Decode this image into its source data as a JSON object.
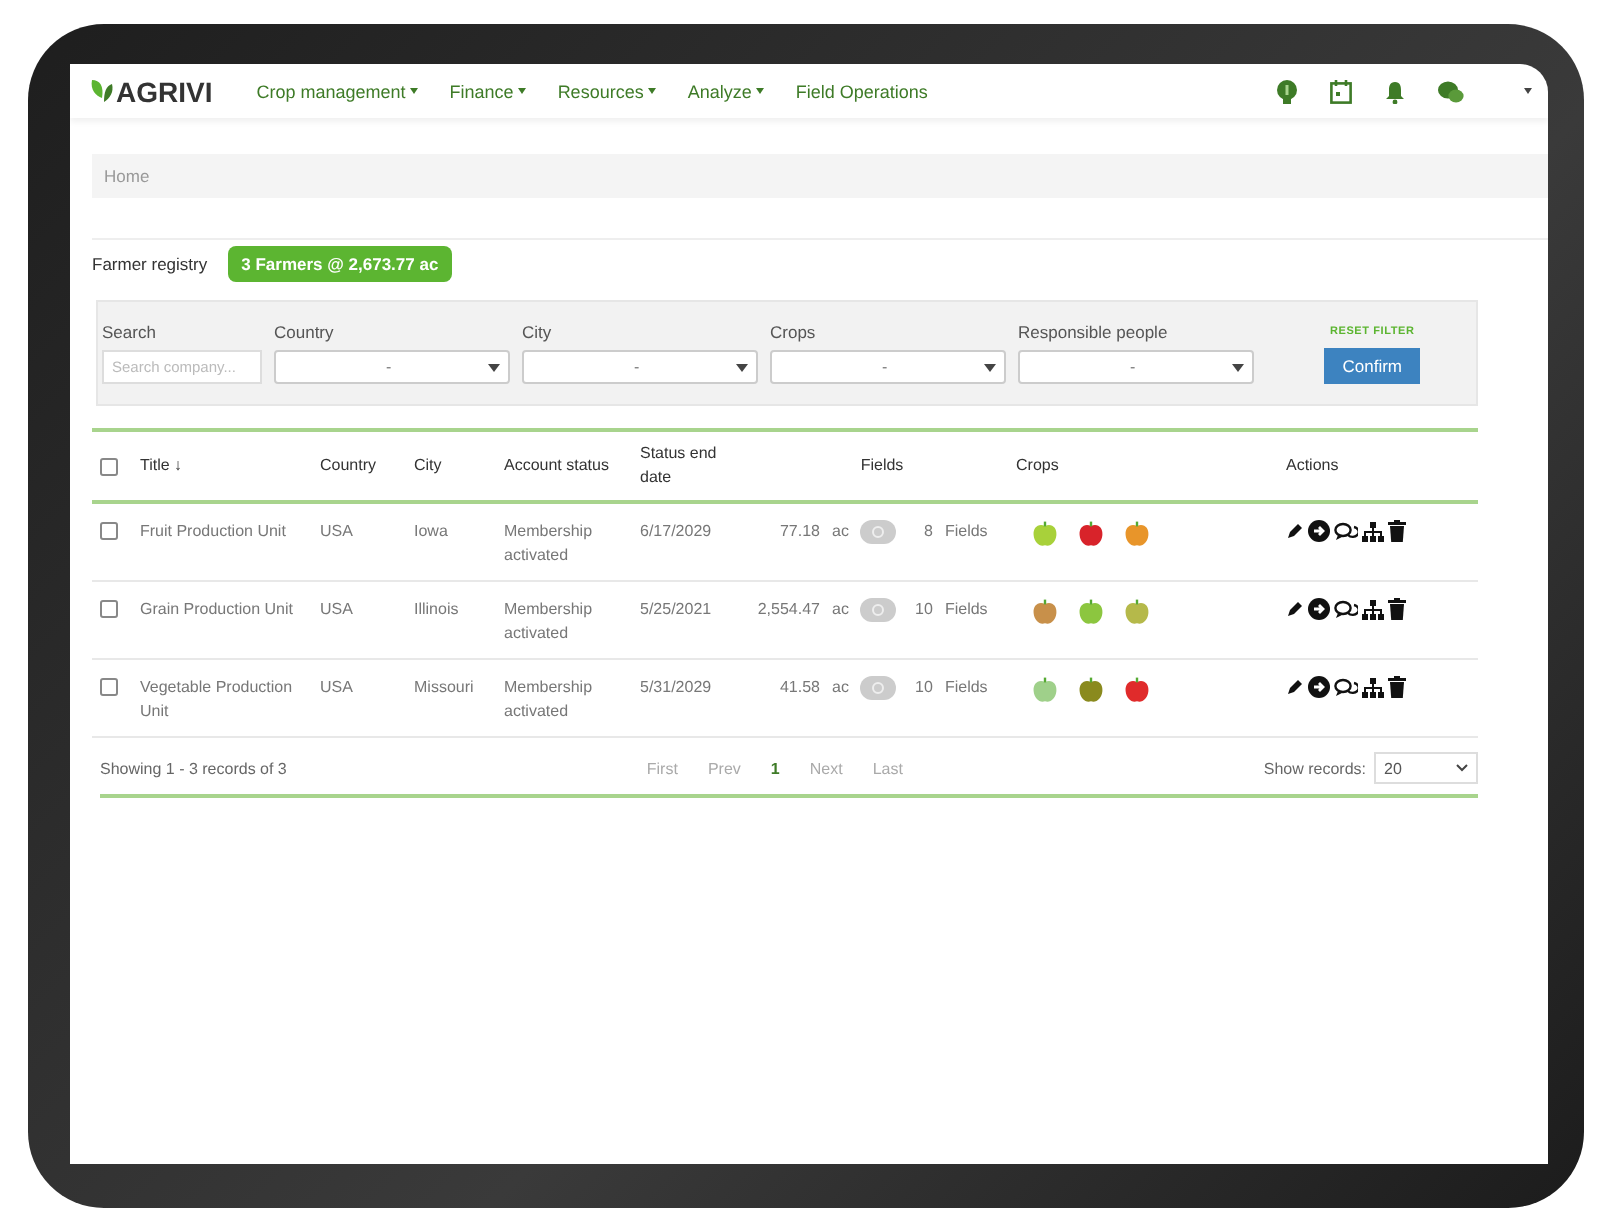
{
  "brand": {
    "name": "AGRIVI"
  },
  "nav": [
    {
      "label": "Crop management",
      "has_caret": true
    },
    {
      "label": "Finance",
      "has_caret": true
    },
    {
      "label": "Resources",
      "has_caret": true
    },
    {
      "label": "Analyze",
      "has_caret": true
    },
    {
      "label": "Field Operations",
      "has_caret": false
    }
  ],
  "breadcrumb": "Home",
  "page_title": "Farmer registry",
  "summary_badge": "3 Farmers @ 2,673.77 ac",
  "filters": {
    "search": {
      "label": "Search",
      "placeholder": "Search company..."
    },
    "selects": [
      {
        "label": "Country",
        "value": "-"
      },
      {
        "label": "City",
        "value": "-"
      },
      {
        "label": "Crops",
        "value": "-"
      },
      {
        "label": "Responsible people",
        "value": "-"
      }
    ],
    "reset": "RESET FILTER",
    "confirm": "Confirm"
  },
  "table": {
    "select_all_checked": false,
    "columns": [
      "Title ↓",
      "Country",
      "City",
      "Account status",
      "Status end date",
      "Fields",
      "Crops",
      "Actions"
    ],
    "rows": [
      {
        "checked": false,
        "title": "Fruit Production Unit",
        "country": "USA",
        "city": "Iowa",
        "status": "Membership activated",
        "end_date": "6/17/2029",
        "area": "77.18",
        "unit": "ac",
        "field_count": "8",
        "fields_label": "Fields",
        "crops": [
          {
            "color": "#a8d13a"
          },
          {
            "color": "#d8232a"
          },
          {
            "color": "#e8952a"
          }
        ]
      },
      {
        "checked": false,
        "title": "Grain Production Unit",
        "country": "USA",
        "city": "Illinois",
        "status": "Membership activated",
        "end_date": "5/25/2021",
        "area": "2,554.47",
        "unit": "ac",
        "field_count": "10",
        "fields_label": "Fields",
        "crops": [
          {
            "color": "#c8904a"
          },
          {
            "color": "#8cc63f"
          },
          {
            "color": "#b5b94a"
          }
        ]
      },
      {
        "checked": false,
        "title": "Vegetable Production Unit",
        "country": "USA",
        "city": "Missouri",
        "status": "Membership activated",
        "end_date": "5/31/2029",
        "area": "41.58",
        "unit": "ac",
        "field_count": "10",
        "fields_label": "Fields",
        "crops": [
          {
            "color": "#9fd08a"
          },
          {
            "color": "#8a8a1e"
          },
          {
            "color": "#e02b2b"
          }
        ]
      }
    ]
  },
  "footer": {
    "showing": "Showing 1 - 3 records of 3",
    "pages": [
      {
        "label": "First",
        "selected": false
      },
      {
        "label": "Prev",
        "selected": false
      },
      {
        "label": "1",
        "selected": true
      },
      {
        "label": "Next",
        "selected": false
      },
      {
        "label": "Last",
        "selected": false
      }
    ],
    "show_records_label": "Show records:",
    "show_records_value": "20"
  }
}
